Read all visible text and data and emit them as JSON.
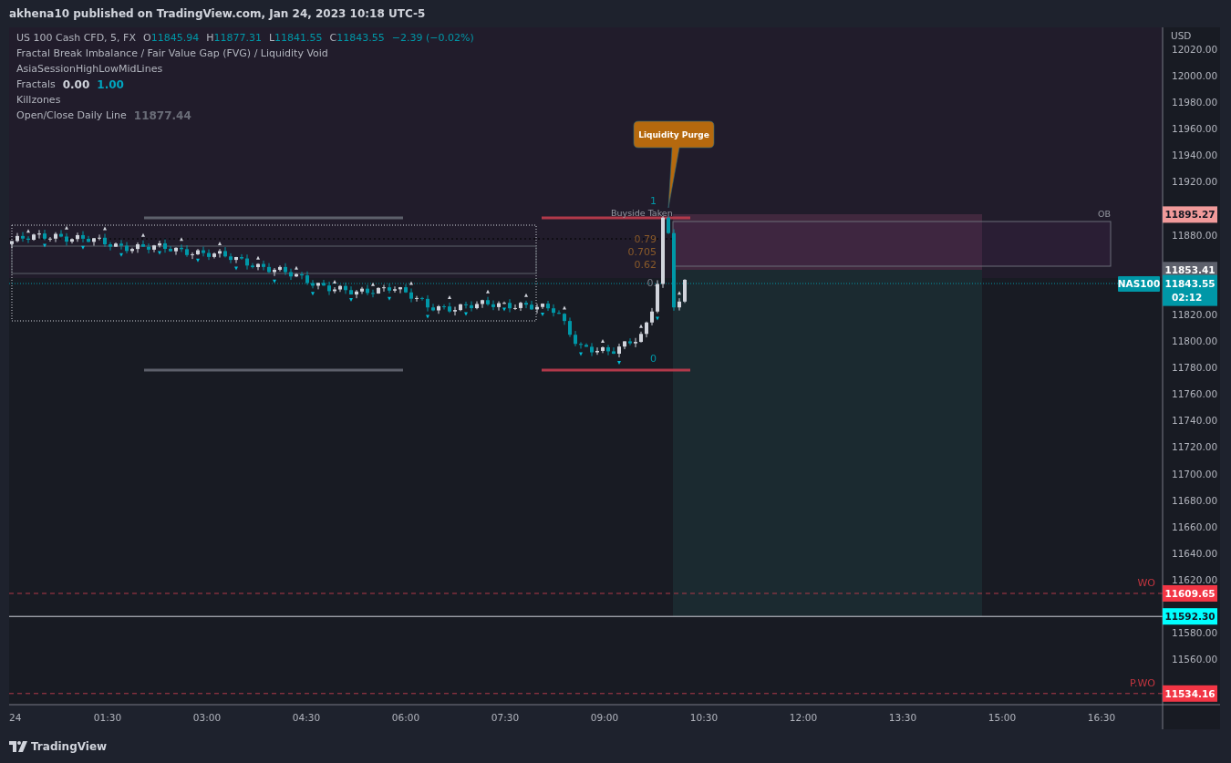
{
  "header": {
    "title": "akhena10 published on TradingView.com, Jan 24, 2023 10:18 UTC-5"
  },
  "legend": {
    "symbol": "US 100 Cash CFD, 5, FX",
    "ohlc": [
      {
        "label": "O",
        "value": "11845.94"
      },
      {
        "label": "H",
        "value": "11877.31"
      },
      {
        "label": "L",
        "value": "11841.55"
      },
      {
        "label": "C",
        "value": "11843.55"
      }
    ],
    "change": "−2.39 (−0.02%)",
    "indicators": [
      {
        "name": "Fractal Break Imbalance / Fair Value Gap (FVG) / Liquidity Void"
      },
      {
        "name": "AsiaSessionHighLowMidLines"
      },
      {
        "name": "Fractals",
        "values": [
          {
            "text": "0.00",
            "color": "#d1d4dc"
          },
          {
            "text": "1.00",
            "color": "#00a6c0"
          }
        ]
      },
      {
        "name": "Killzones"
      },
      {
        "name": "Open/Close Daily Line",
        "values": [
          {
            "text": "11877.44",
            "color": "#6a6d78"
          }
        ]
      }
    ]
  },
  "chart": {
    "callout": "Liquidity Purge",
    "buyside": "Buyside Taken",
    "fib_levels": [
      {
        "text": "1",
        "kind": "top"
      },
      {
        "text": "0.79",
        "kind": "mid"
      },
      {
        "text": "0.705",
        "kind": "mid"
      },
      {
        "text": "0.62",
        "kind": "mid"
      },
      {
        "text": "0.",
        "kind": "half"
      },
      {
        "text": "0",
        "kind": "bottom"
      }
    ],
    "ob_label": "OB",
    "wo_label": "WO",
    "pwo_label": "P.WO",
    "symbol_tag": "NAS100"
  },
  "price_axis": {
    "currency": "USD",
    "ticks": [
      "12020.00",
      "12000.00",
      "11980.00",
      "11960.00",
      "11940.00",
      "11920.00",
      "11880.00",
      "11820.00",
      "11800.00",
      "11780.00",
      "11760.00",
      "11740.00",
      "11720.00",
      "11700.00",
      "11680.00",
      "11660.00",
      "11640.00",
      "11620.00",
      "11580.00",
      "11560.00"
    ],
    "tags": [
      {
        "text": "11895.27",
        "color": "#f09a9a"
      },
      {
        "text": "11853.41",
        "color": "#5d606b"
      },
      {
        "text": "11843.55",
        "sub": "02:12",
        "color": "#0097a7"
      },
      {
        "text": "11609.65",
        "color": "#f23645"
      },
      {
        "text": "11592.30",
        "color": "#00ffff"
      },
      {
        "text": "11534.16",
        "color": "#f23645"
      }
    ]
  },
  "time_axis": {
    "ticks": [
      "24",
      "01:30",
      "03:00",
      "04:30",
      "06:00",
      "07:30",
      "09:00",
      "10:30",
      "12:00",
      "13:30",
      "15:00",
      "16:30"
    ]
  },
  "footer": {
    "brand": "TradingView"
  }
}
